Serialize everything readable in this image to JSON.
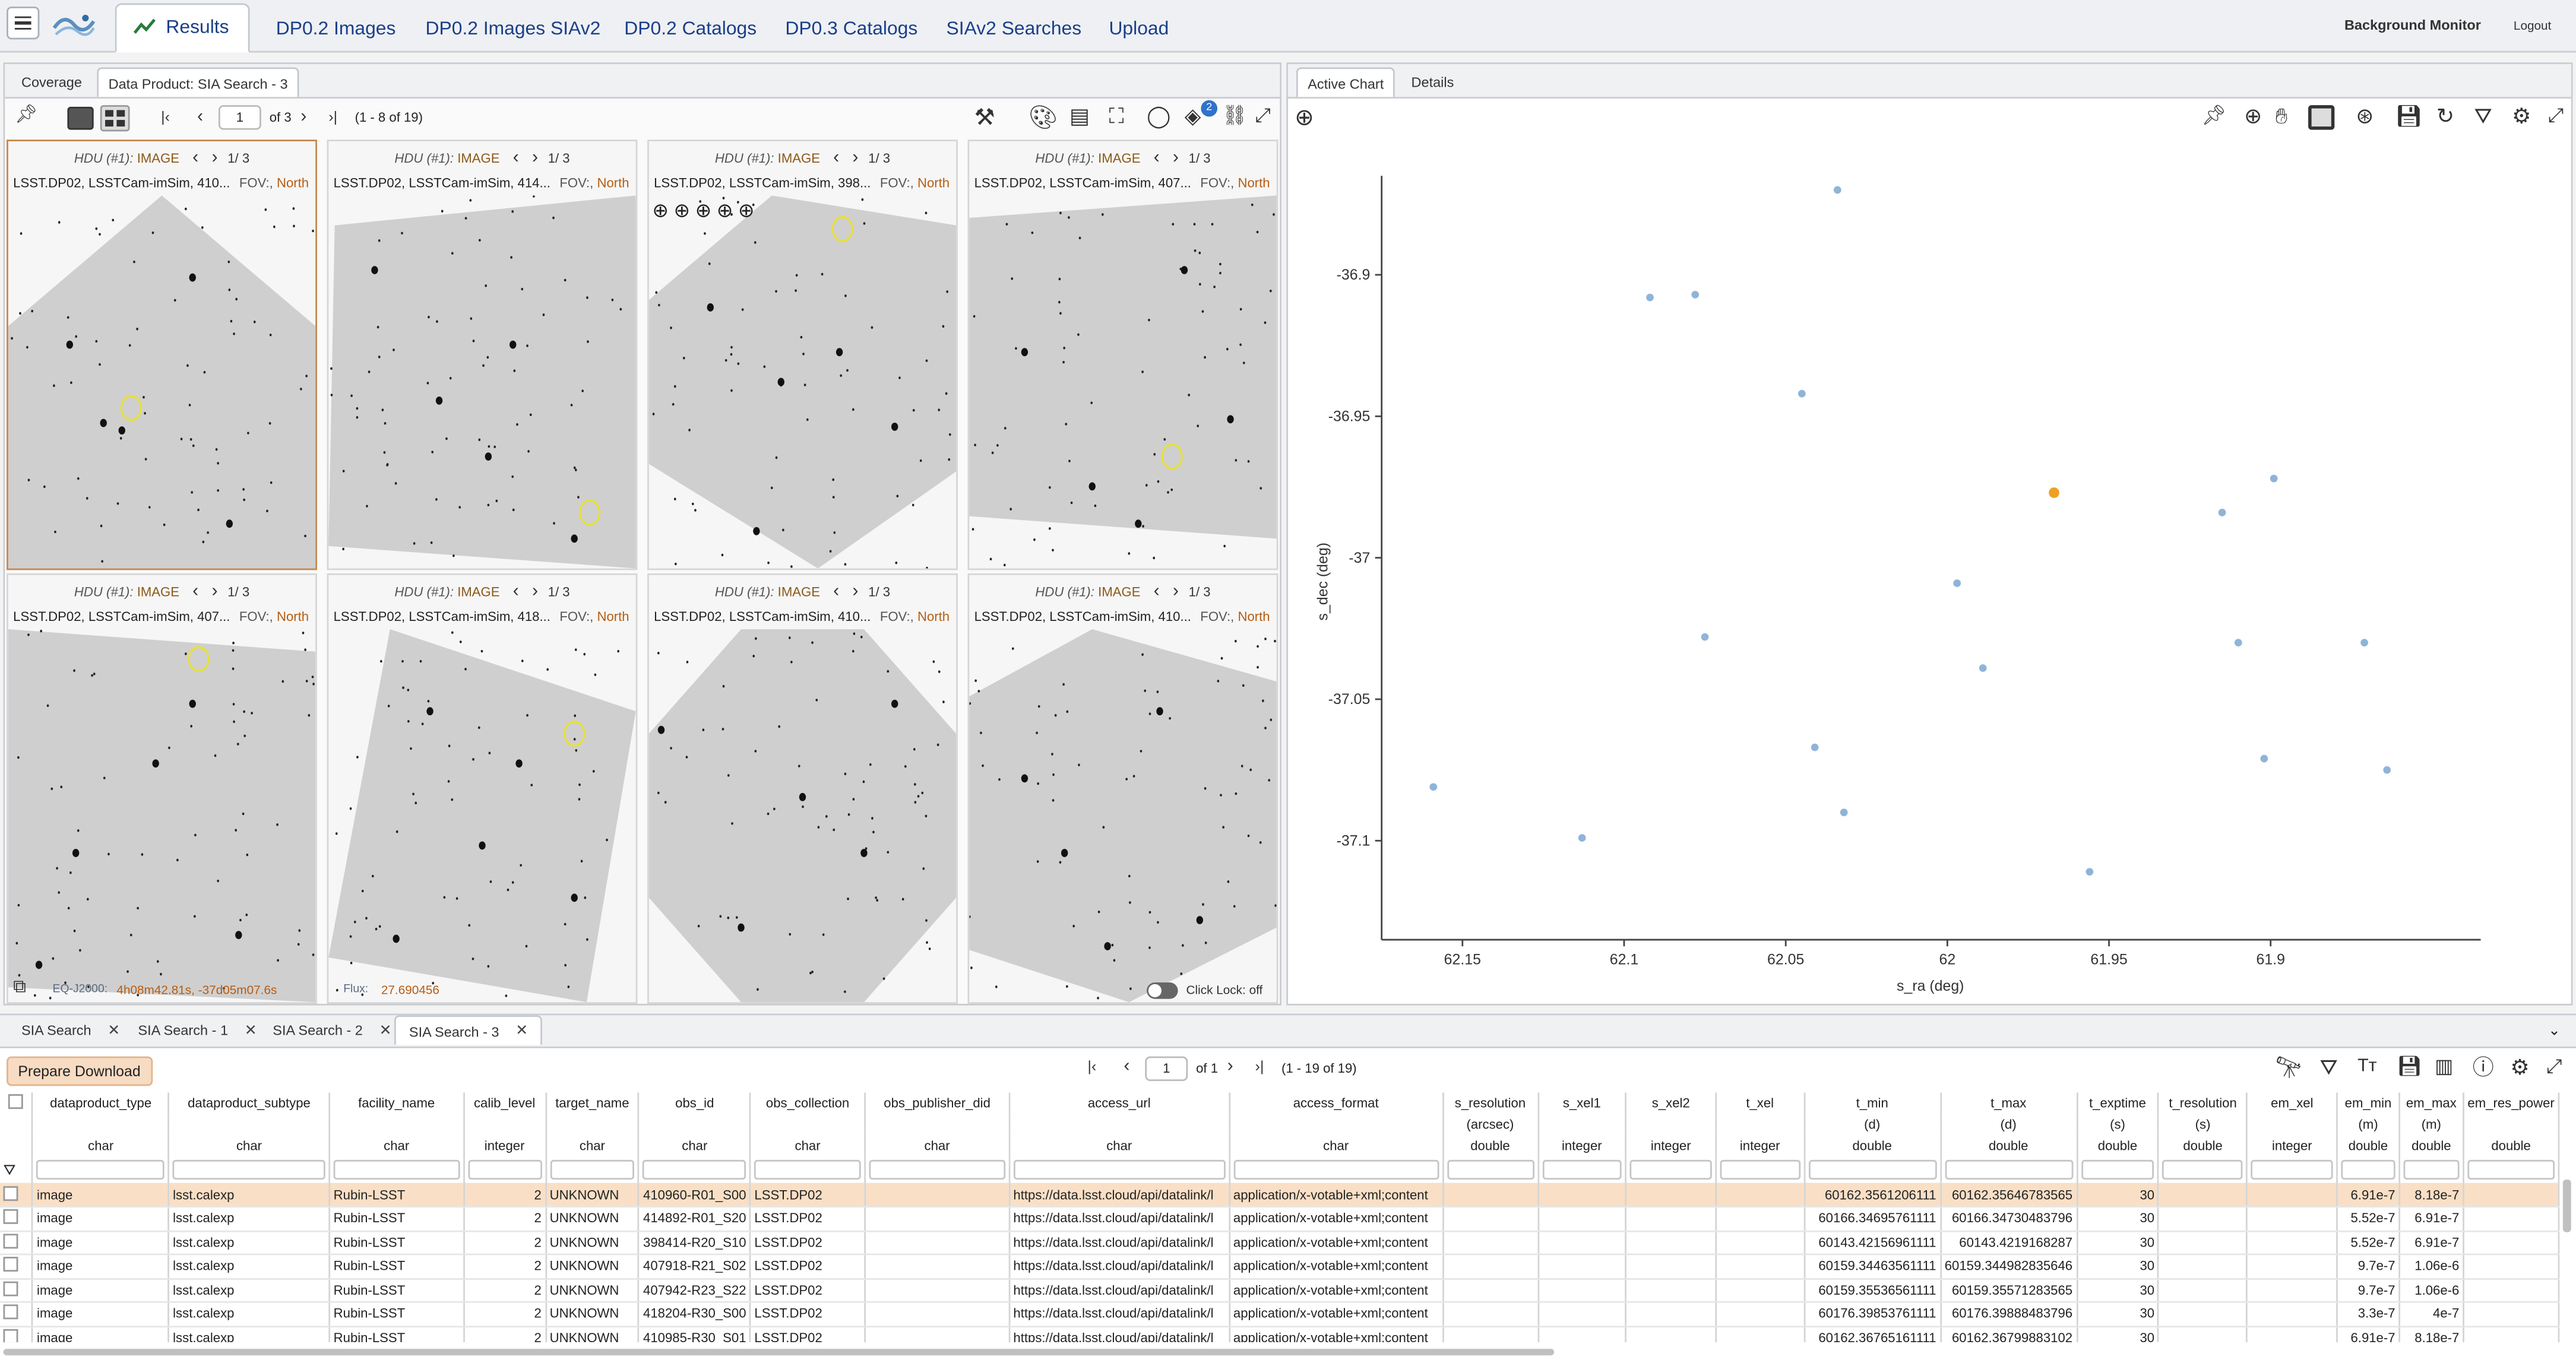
{
  "top_tabs": [
    "Results",
    "DP0.2 Images",
    "DP0.2 Images SIAv2",
    "DP0.2 Catalogs",
    "DP0.3 Catalogs",
    "SIAv2 Searches",
    "Upload"
  ],
  "background_monitor": "Background Monitor",
  "logout": "Logout",
  "left_tabs": [
    "Coverage",
    "Data Product: SIA Search - 3"
  ],
  "pager": {
    "page": "1",
    "of": "of 3",
    "range": "(1 - 8 of 19)"
  },
  "layers_badge": "2",
  "tiles": [
    {
      "hdu": "HDU (#1):",
      "type": "IMAGE",
      "page": "1/ 3",
      "title": "LSST.DP02, LSSTCam-imSim, 410...",
      "fov": "FOV:,",
      "north": "North"
    },
    {
      "hdu": "HDU (#1):",
      "type": "IMAGE",
      "page": "1/ 3",
      "title": "LSST.DP02, LSSTCam-imSim, 414...",
      "fov": "FOV:,",
      "north": "North"
    },
    {
      "hdu": "HDU (#1):",
      "type": "IMAGE",
      "page": "1/ 3",
      "title": "LSST.DP02, LSSTCam-imSim, 398...",
      "fov": "FOV:,",
      "north": "North"
    },
    {
      "hdu": "HDU (#1):",
      "type": "IMAGE",
      "page": "1/ 3",
      "title": "LSST.DP02, LSSTCam-imSim, 407...",
      "fov": "FOV:,",
      "north": "North"
    },
    {
      "hdu": "HDU (#1):",
      "type": "IMAGE",
      "page": "1/ 3",
      "title": "LSST.DP02, LSSTCam-imSim, 407...",
      "fov": "FOV:,",
      "north": "North"
    },
    {
      "hdu": "HDU (#1):",
      "type": "IMAGE",
      "page": "1/ 3",
      "title": "LSST.DP02, LSSTCam-imSim, 418...",
      "fov": "FOV:,",
      "north": "North"
    },
    {
      "hdu": "HDU (#1):",
      "type": "IMAGE",
      "page": "1/ 3",
      "title": "LSST.DP02, LSSTCam-imSim, 410...",
      "fov": "FOV:,",
      "north": "North"
    },
    {
      "hdu": "HDU (#1):",
      "type": "IMAGE",
      "page": "1/ 3",
      "title": "LSST.DP02, LSSTCam-imSim, 410...",
      "fov": "FOV:,",
      "north": "North"
    }
  ],
  "readout": {
    "coord_label": "EQ-J2000:",
    "coord_value": "4h08m42.81s, -37d05m07.6s",
    "flux_label": "Flux:",
    "flux_value": "27.690456",
    "click_lock": "Click Lock: off"
  },
  "right_tabs": [
    "Active Chart",
    "Details"
  ],
  "chart_data": {
    "type": "scatter",
    "xlabel": "s_ra (deg)",
    "ylabel": "s_dec (deg)",
    "xlim": [
      62.175,
      61.835
    ],
    "ylim": [
      -37.135,
      -36.865
    ],
    "x_ticks": [
      "62.15",
      "62.1",
      "62.05",
      "62",
      "61.95",
      "61.9"
    ],
    "x_tick_values": [
      62.15,
      62.1,
      62.05,
      62,
      61.95,
      61.9
    ],
    "y_ticks": [
      "-36.9",
      "-36.95",
      "-37",
      "-37.05",
      "-37.1"
    ],
    "y_tick_values": [
      -36.9,
      -36.95,
      -37,
      -37.05,
      -37.1
    ],
    "points": [
      {
        "x": 62.034,
        "y": -36.87
      },
      {
        "x": 62.092,
        "y": -36.908
      },
      {
        "x": 62.078,
        "y": -36.907
      },
      {
        "x": 62.045,
        "y": -36.942
      },
      {
        "x": 61.899,
        "y": -36.972
      },
      {
        "x": 61.915,
        "y": -36.984
      },
      {
        "x": 61.997,
        "y": -37.009
      },
      {
        "x": 62.075,
        "y": -37.028
      },
      {
        "x": 61.91,
        "y": -37.03
      },
      {
        "x": 61.871,
        "y": -37.03
      },
      {
        "x": 61.989,
        "y": -37.039
      },
      {
        "x": 62.041,
        "y": -37.067
      },
      {
        "x": 61.902,
        "y": -37.071
      },
      {
        "x": 61.864,
        "y": -37.075
      },
      {
        "x": 62.032,
        "y": -37.09
      },
      {
        "x": 62.159,
        "y": -37.081
      },
      {
        "x": 62.113,
        "y": -37.099
      },
      {
        "x": 61.956,
        "y": -37.111
      }
    ],
    "highlight": {
      "x": 61.967,
      "y": -36.977
    },
    "point_color": "#8fb4d8",
    "highlight_color": "#f0a020"
  },
  "grid_tabs": [
    "SIA Search",
    "SIA Search - 1",
    "SIA Search - 2",
    "SIA Search - 3"
  ],
  "table_pager": {
    "page": "1",
    "of": "of 1",
    "range": "(1 - 19 of 19)"
  },
  "prepare_download": "Prepare Download",
  "columns": [
    {
      "name": "dataproduct_type",
      "type": "char"
    },
    {
      "name": "dataproduct_subtype",
      "type": "char"
    },
    {
      "name": "facility_name",
      "type": "char"
    },
    {
      "name": "calib_level",
      "type": "integer"
    },
    {
      "name": "target_name",
      "type": "char"
    },
    {
      "name": "obs_id",
      "type": "char"
    },
    {
      "name": "obs_collection",
      "type": "char"
    },
    {
      "name": "obs_publisher_did",
      "type": "char"
    },
    {
      "name": "access_url",
      "type": "char"
    },
    {
      "name": "access_format",
      "type": "char"
    },
    {
      "name": "s_resolution",
      "unit": "(arcsec)",
      "type": "double"
    },
    {
      "name": "s_xel1",
      "type": "integer"
    },
    {
      "name": "s_xel2",
      "type": "integer"
    },
    {
      "name": "t_xel",
      "type": "integer"
    },
    {
      "name": "t_min",
      "unit": "(d)",
      "type": "double"
    },
    {
      "name": "t_max",
      "unit": "(d)",
      "type": "double"
    },
    {
      "name": "t_exptime",
      "unit": "(s)",
      "type": "double"
    },
    {
      "name": "t_resolution",
      "unit": "(s)",
      "type": "double"
    },
    {
      "name": "em_xel",
      "type": "integer"
    },
    {
      "name": "em_min",
      "unit": "(m)",
      "type": "double"
    },
    {
      "name": "em_max",
      "unit": "(m)",
      "type": "double"
    },
    {
      "name": "em_res_power",
      "type": "double"
    }
  ],
  "rows": [
    [
      "image",
      "lsst.calexp",
      "Rubin-LSST",
      "2",
      "UNKNOWN",
      "410960-R01_S00",
      "LSST.DP02",
      "",
      "https://data.lsst.cloud/api/datalink/l",
      "application/x-votable+xml;content",
      "",
      "",
      "",
      "",
      "60162.3561206111",
      "60162.35646783565",
      "30",
      "",
      "",
      "6.91e-7",
      "8.18e-7",
      ""
    ],
    [
      "image",
      "lsst.calexp",
      "Rubin-LSST",
      "2",
      "UNKNOWN",
      "414892-R01_S20",
      "LSST.DP02",
      "",
      "https://data.lsst.cloud/api/datalink/l",
      "application/x-votable+xml;content",
      "",
      "",
      "",
      "",
      "60166.34695761111",
      "60166.34730483796",
      "30",
      "",
      "",
      "5.52e-7",
      "6.91e-7",
      ""
    ],
    [
      "image",
      "lsst.calexp",
      "Rubin-LSST",
      "2",
      "UNKNOWN",
      "398414-R20_S10",
      "LSST.DP02",
      "",
      "https://data.lsst.cloud/api/datalink/l",
      "application/x-votable+xml;content",
      "",
      "",
      "",
      "",
      "60143.42156961111",
      "60143.4219168287",
      "30",
      "",
      "",
      "5.52e-7",
      "6.91e-7",
      ""
    ],
    [
      "image",
      "lsst.calexp",
      "Rubin-LSST",
      "2",
      "UNKNOWN",
      "407918-R21_S02",
      "LSST.DP02",
      "",
      "https://data.lsst.cloud/api/datalink/l",
      "application/x-votable+xml;content",
      "",
      "",
      "",
      "",
      "60159.34463561111",
      "60159.344982835646",
      "30",
      "",
      "",
      "9.7e-7",
      "1.06e-6",
      ""
    ],
    [
      "image",
      "lsst.calexp",
      "Rubin-LSST",
      "2",
      "UNKNOWN",
      "407942-R23_S22",
      "LSST.DP02",
      "",
      "https://data.lsst.cloud/api/datalink/l",
      "application/x-votable+xml;content",
      "",
      "",
      "",
      "",
      "60159.35536561111",
      "60159.35571283565",
      "30",
      "",
      "",
      "9.7e-7",
      "1.06e-6",
      ""
    ],
    [
      "image",
      "lsst.calexp",
      "Rubin-LSST",
      "2",
      "UNKNOWN",
      "418204-R30_S00",
      "LSST.DP02",
      "",
      "https://data.lsst.cloud/api/datalink/l",
      "application/x-votable+xml;content",
      "",
      "",
      "",
      "",
      "60176.39853761111",
      "60176.39888483796",
      "30",
      "",
      "",
      "3.3e-7",
      "4e-7",
      ""
    ],
    [
      "image",
      "lsst.calexp",
      "Rubin-LSST",
      "2",
      "UNKNOWN",
      "410985-R30_S01",
      "LSST.DP02",
      "",
      "https://data.lsst.cloud/api/datalink/l",
      "application/x-votable+xml;content",
      "",
      "",
      "",
      "",
      "60162.36765161111",
      "60162.36799883102",
      "30",
      "",
      "",
      "6.91e-7",
      "8.18e-7",
      ""
    ]
  ]
}
